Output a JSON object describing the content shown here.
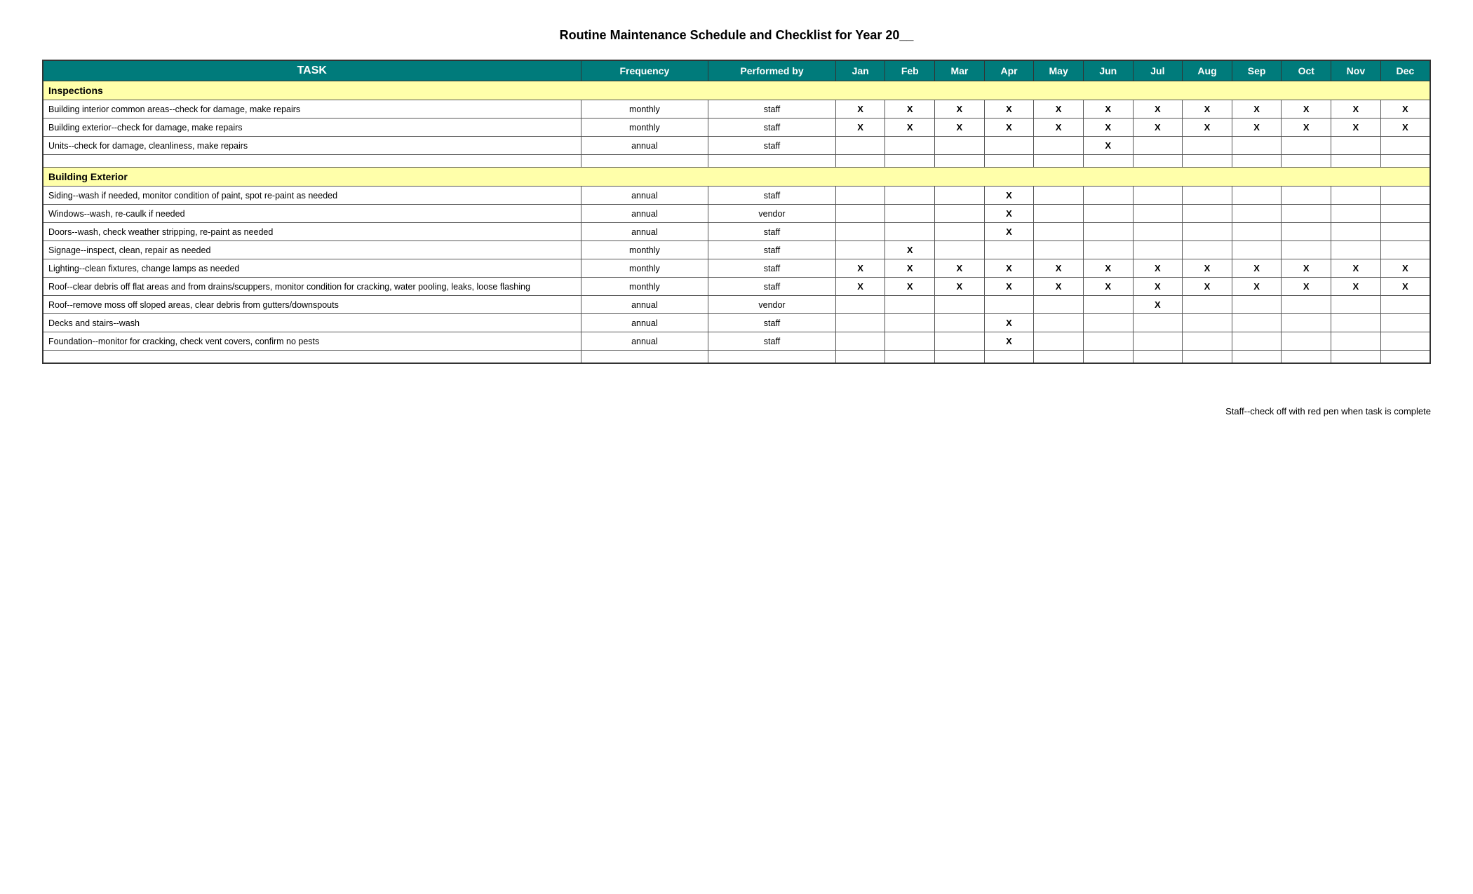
{
  "title": "Routine Maintenance Schedule and Checklist for Year 20__",
  "header": {
    "task": "TASK",
    "frequency": "Frequency",
    "performed_by": "Performed by",
    "months": [
      "Jan",
      "Feb",
      "Mar",
      "Apr",
      "May",
      "Jun",
      "Jul",
      "Aug",
      "Sep",
      "Oct",
      "Nov",
      "Dec"
    ]
  },
  "sections": [
    {
      "name": "Inspections",
      "rows": [
        {
          "task": "Building interior common areas--check for damage, make repairs",
          "frequency": "monthly",
          "performed_by": "staff",
          "months": [
            true,
            true,
            true,
            true,
            true,
            true,
            true,
            true,
            true,
            true,
            true,
            true
          ]
        },
        {
          "task": "Building exterior--check for damage, make repairs",
          "frequency": "monthly",
          "performed_by": "staff",
          "months": [
            true,
            true,
            true,
            true,
            true,
            true,
            true,
            true,
            true,
            true,
            true,
            true
          ]
        },
        {
          "task": "Units--check for damage, cleanliness, make repairs",
          "frequency": "annual",
          "performed_by": "staff",
          "months": [
            false,
            false,
            false,
            false,
            false,
            true,
            false,
            false,
            false,
            false,
            false,
            false
          ]
        }
      ]
    },
    {
      "name": "Building Exterior",
      "rows": [
        {
          "task": "Siding--wash if needed, monitor condition of paint, spot re-paint as needed",
          "frequency": "annual",
          "performed_by": "staff",
          "months": [
            false,
            false,
            false,
            true,
            false,
            false,
            false,
            false,
            false,
            false,
            false,
            false
          ]
        },
        {
          "task": "Windows--wash, re-caulk if needed",
          "frequency": "annual",
          "performed_by": "vendor",
          "months": [
            false,
            false,
            false,
            true,
            false,
            false,
            false,
            false,
            false,
            false,
            false,
            false
          ]
        },
        {
          "task": "Doors--wash, check weather stripping, re-paint as needed",
          "frequency": "annual",
          "performed_by": "staff",
          "months": [
            false,
            false,
            false,
            true,
            false,
            false,
            false,
            false,
            false,
            false,
            false,
            false
          ]
        },
        {
          "task": "Signage--inspect, clean, repair as needed",
          "frequency": "monthly",
          "performed_by": "staff",
          "months": [
            false,
            true,
            false,
            false,
            false,
            false,
            false,
            false,
            false,
            false,
            false,
            false
          ]
        },
        {
          "task": "Lighting--clean fixtures, change lamps as needed",
          "frequency": "monthly",
          "performed_by": "staff",
          "months": [
            true,
            true,
            true,
            true,
            true,
            true,
            true,
            true,
            true,
            true,
            true,
            true
          ]
        },
        {
          "task": "Roof--clear debris off flat areas and from drains/scuppers, monitor condition for cracking, water pooling, leaks, loose flashing",
          "frequency": "monthly",
          "performed_by": "staff",
          "months": [
            true,
            true,
            true,
            true,
            true,
            true,
            true,
            true,
            true,
            true,
            true,
            true
          ]
        },
        {
          "task": "Roof--remove moss off sloped areas, clear debris from gutters/downspouts",
          "frequency": "annual",
          "performed_by": "vendor",
          "months": [
            false,
            false,
            false,
            false,
            false,
            false,
            true,
            false,
            false,
            false,
            false,
            false
          ]
        },
        {
          "task": "Decks and stairs--wash",
          "frequency": "annual",
          "performed_by": "staff",
          "months": [
            false,
            false,
            false,
            true,
            false,
            false,
            false,
            false,
            false,
            false,
            false,
            false
          ]
        },
        {
          "task": "Foundation--monitor for cracking, check vent covers, confirm no pests",
          "frequency": "annual",
          "performed_by": "staff",
          "months": [
            false,
            false,
            false,
            true,
            false,
            false,
            false,
            false,
            false,
            false,
            false,
            false
          ]
        }
      ]
    }
  ],
  "footer_note": "Staff--check off with red pen when task is complete"
}
